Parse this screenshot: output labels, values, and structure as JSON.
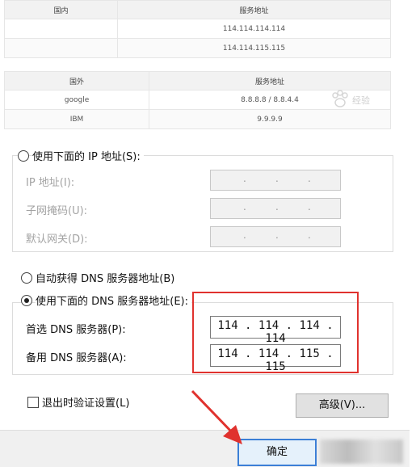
{
  "domestic_table": {
    "headers": [
      "国内",
      "服务地址"
    ],
    "rows": [
      [
        "",
        "114.114.114.114"
      ],
      [
        "",
        "114.114.115.115"
      ]
    ]
  },
  "foreign_table": {
    "headers": [
      "国外",
      "服务地址"
    ],
    "rows": [
      [
        "google",
        "8.8.8.8 / 8.8.4.4"
      ],
      [
        "IBM",
        "9.9.9.9"
      ]
    ]
  },
  "dialog": {
    "ip_manual_radio": "使用下面的 IP 地址(S):",
    "ip_label": "IP 地址(I):",
    "subnet_label": "子网掩码(U):",
    "gateway_label": "默认网关(D):",
    "ip_dot": ".",
    "dns_auto_radio": "自动获得 DNS 服务器地址(B)",
    "dns_manual_radio": "使用下面的 DNS 服务器地址(E):",
    "preferred_dns_label": "首选 DNS 服务器(P):",
    "preferred_dns_value": "114 . 114 . 114 . 114",
    "alternate_dns_label": "备用 DNS 服务器(A):",
    "alternate_dns_value": "114 . 114 . 115 . 115",
    "validate_checkbox_label": "退出时验证设置(L)",
    "advanced_button": "高级(V)...",
    "ok_button": "确定"
  },
  "colors": {
    "highlight_box": "#e0322e",
    "arrow": "#e0322e",
    "primary_button_border": "#3c7fd6"
  },
  "watermark": "经验"
}
